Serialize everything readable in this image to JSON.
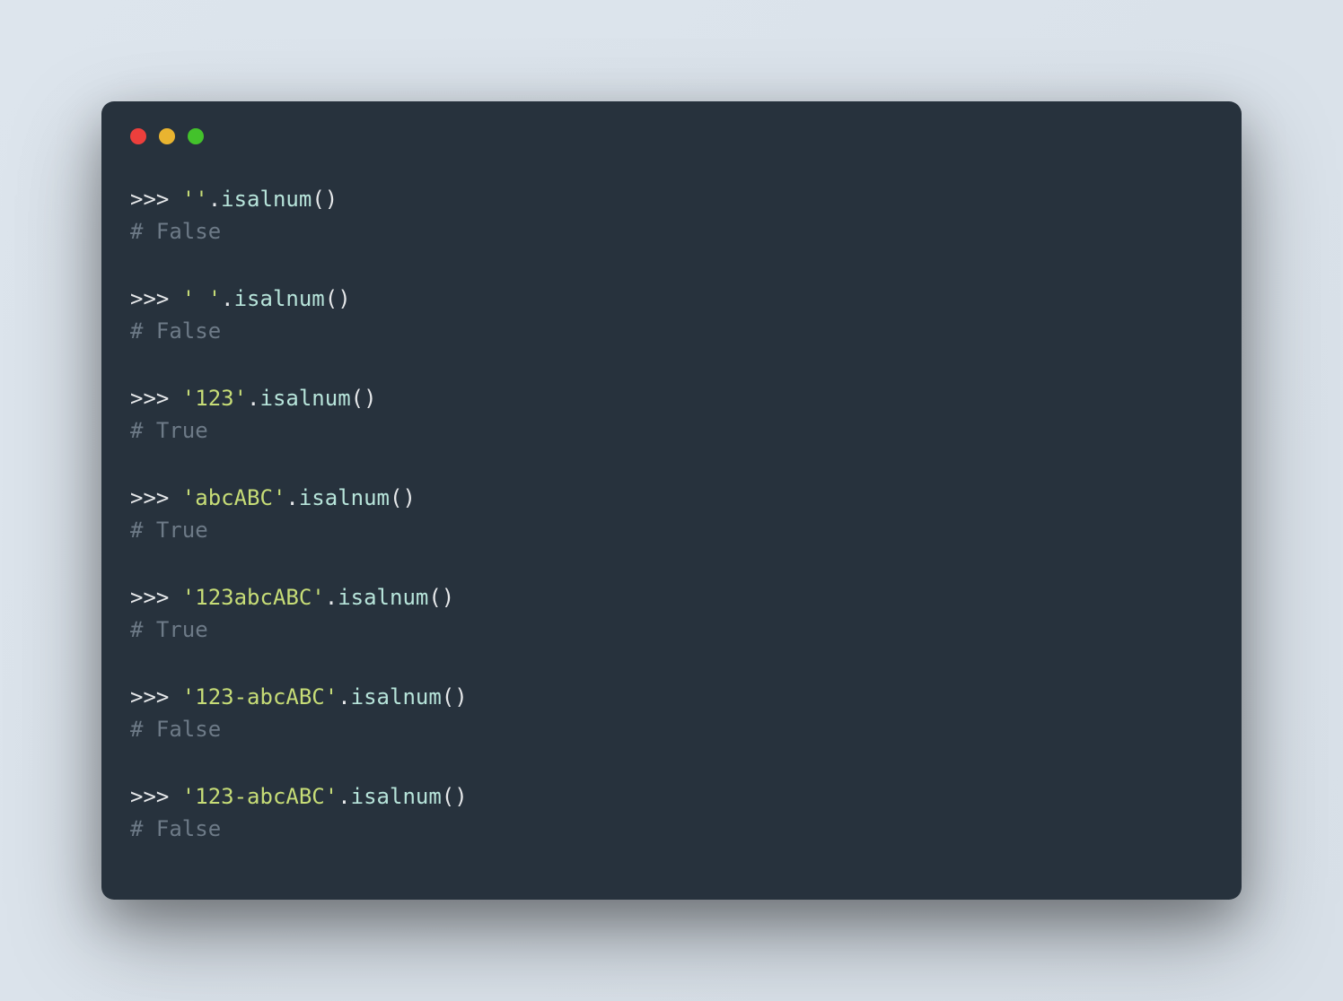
{
  "traffic_lights": {
    "red": "#ed3f3c",
    "yellow": "#e9b430",
    "green": "#43c22b"
  },
  "code_blocks": [
    {
      "prompt": ">>> ",
      "string": "''",
      "dot": ".",
      "method": "isalnum",
      "parens": "()",
      "comment": "# False"
    },
    {
      "prompt": ">>> ",
      "string": "' '",
      "dot": ".",
      "method": "isalnum",
      "parens": "()",
      "comment": "# False"
    },
    {
      "prompt": ">>> ",
      "string": "'123'",
      "dot": ".",
      "method": "isalnum",
      "parens": "()",
      "comment": "# True"
    },
    {
      "prompt": ">>> ",
      "string": "'abcABC'",
      "dot": ".",
      "method": "isalnum",
      "parens": "()",
      "comment": "# True"
    },
    {
      "prompt": ">>> ",
      "string": "'123abcABC'",
      "dot": ".",
      "method": "isalnum",
      "parens": "()",
      "comment": "# True"
    },
    {
      "prompt": ">>> ",
      "string": "'123-abcABC'",
      "dot": ".",
      "method": "isalnum",
      "parens": "()",
      "comment": "# False"
    },
    {
      "prompt": ">>> ",
      "string": "'123-abcABC'",
      "dot": ".",
      "method": "isalnum",
      "parens": "()",
      "comment": "# False"
    }
  ]
}
